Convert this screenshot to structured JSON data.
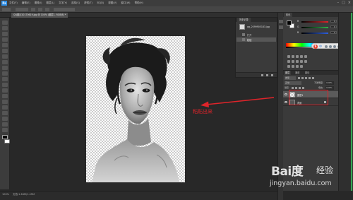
{
  "app": {
    "logo": "Ps",
    "menus": [
      "文件(F)",
      "编辑(E)",
      "图像(I)",
      "图层(L)",
      "文字(Y)",
      "选择(S)",
      "滤镜(T)",
      "3D(D)",
      "视图(V)",
      "窗口(W)",
      "帮助(H)"
    ],
    "window_controls": [
      "–",
      "□",
      "×"
    ]
  },
  "document": {
    "tab_title": "QQ图片20170619.jpg @ 100% (图层1, RGB/8) *",
    "zoom": "100%",
    "status_text": "文档:1.64M/1.45M"
  },
  "history": {
    "tab": "历史记录",
    "snapshot_name": "qq_2099905183.jpg",
    "rows": [
      {
        "label": "打开",
        "active": false
      },
      {
        "label": "粘贴",
        "active": true
      }
    ]
  },
  "color_panel": {
    "tab": "颜色",
    "channels": [
      {
        "label": "R",
        "value": "0",
        "color": "#e0242a"
      },
      {
        "label": "G",
        "value": "0",
        "color": "#2fb34a"
      },
      {
        "label": "B",
        "value": "0",
        "color": "#2d5fe0"
      }
    ]
  },
  "ime_badge": {
    "s_label": "S",
    "lang": "中"
  },
  "layers_panel": {
    "tabs": [
      "图层",
      "通道",
      "路径"
    ],
    "kind_filter": "类型",
    "blend_mode": "正常",
    "opacity_label": "不透明度:",
    "opacity_value": "100%",
    "lock_label": "锁定:",
    "fill_label": "填充:",
    "fill_value": "100%",
    "layers": [
      {
        "name": "图层1",
        "selected": true,
        "thumb": "transparent"
      },
      {
        "name": "背景",
        "selected": false,
        "thumb": "dark"
      }
    ]
  },
  "annotation": {
    "text": "粘贴出来",
    "color": "#e0242a"
  },
  "watermark": {
    "logo": "Bai度",
    "sub": "经验",
    "url": "jingyan.baidu.com"
  }
}
